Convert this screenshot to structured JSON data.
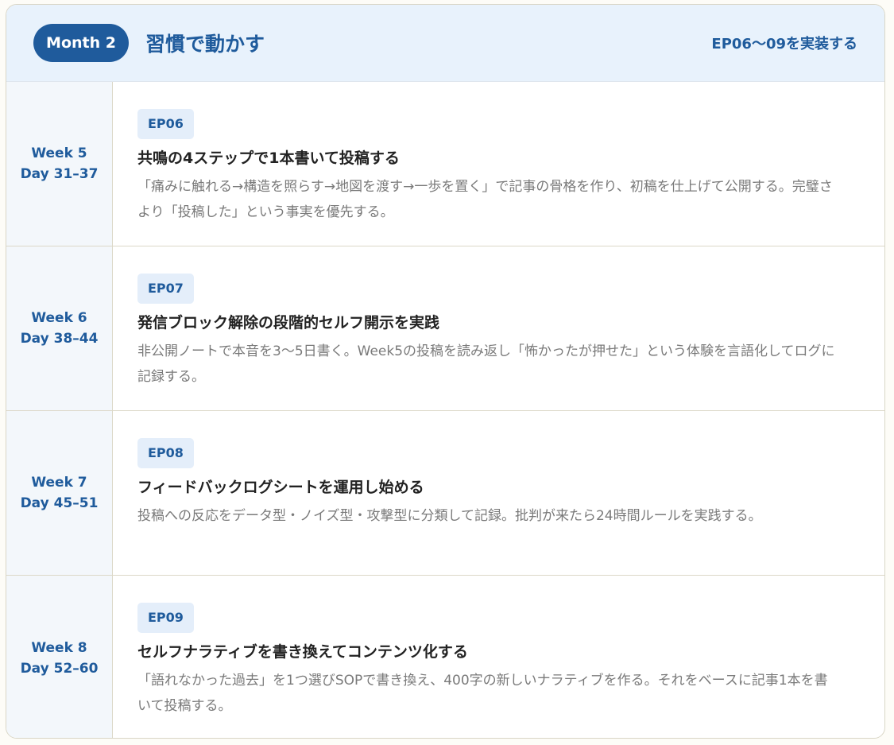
{
  "header": {
    "month": "Month 2",
    "title": "習慣で動かす",
    "subtitle": "EP06〜09を実装する"
  },
  "rows": [
    {
      "week": "Week 5",
      "days": "Day 31–37",
      "ep": "EP06",
      "title": "共鳴の4ステップで1本書いて投稿する",
      "desc": "「痛みに触れる→構造を照らす→地図を渡す→一歩を置く」で記事の骨格を作り、初稿を仕上げて公開する。完璧さより「投稿した」という事実を優先する。"
    },
    {
      "week": "Week 6",
      "days": "Day 38–44",
      "ep": "EP07",
      "title": "発信ブロック解除の段階的セルフ開示を実践",
      "desc": "非公開ノートで本音を3〜5日書く。Week5の投稿を読み返し「怖かったが押せた」という体験を言語化してログに記録する。"
    },
    {
      "week": "Week 7",
      "days": "Day 45–51",
      "ep": "EP08",
      "title": "フィードバックログシートを運用し始める",
      "desc": "投稿への反応をデータ型・ノイズ型・攻撃型に分類して記録。批判が来たら24時間ルールを実践する。"
    },
    {
      "week": "Week 8",
      "days": "Day 52–60",
      "ep": "EP09",
      "title": "セルフナラティブを書き換えてコンテンツ化する",
      "desc": "「語れなかった過去」を1つ選びSOPで書き換え、400字の新しいナラティブを作る。それをベースに記事1本を書いて投稿する。"
    }
  ]
}
